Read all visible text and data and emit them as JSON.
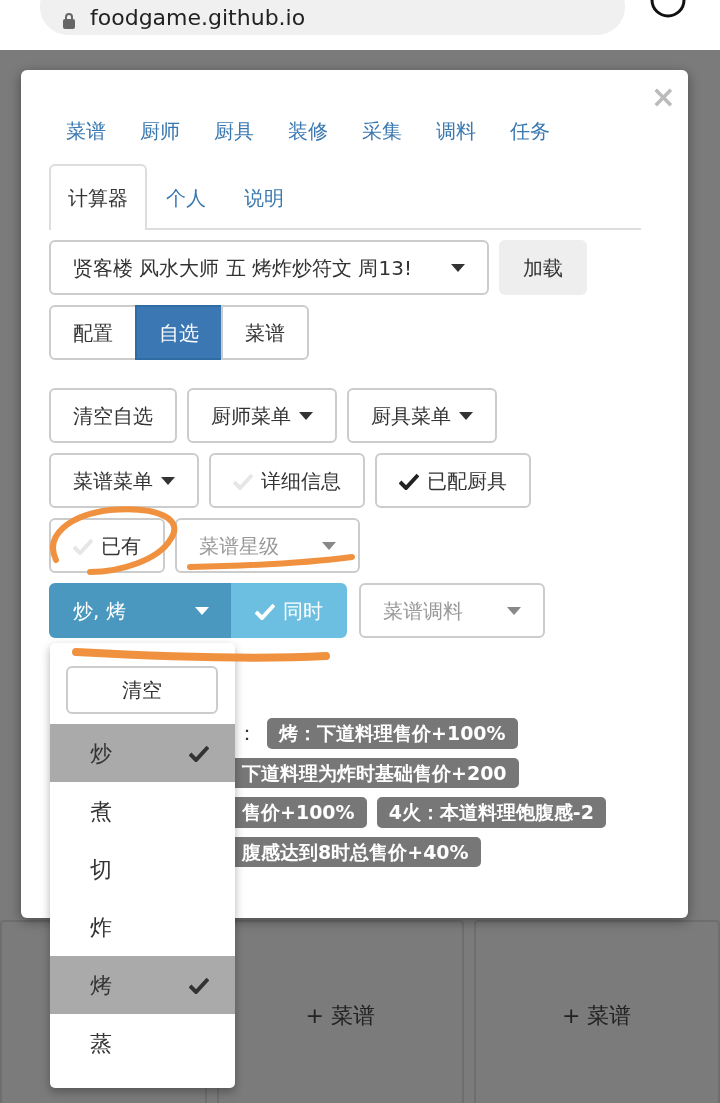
{
  "browser": {
    "url": "foodgame.github.io"
  },
  "modal": {
    "close": "×",
    "top_nav": [
      {
        "label": "菜谱"
      },
      {
        "label": "厨师"
      },
      {
        "label": "厨具"
      },
      {
        "label": "装修"
      },
      {
        "label": "采集"
      },
      {
        "label": "调料"
      },
      {
        "label": "任务"
      }
    ],
    "sub_tabs": [
      {
        "label": "计算器",
        "selected": true
      },
      {
        "label": "个人",
        "selected": false
      },
      {
        "label": "说明",
        "selected": false
      }
    ],
    "preset_select": {
      "value": "贤客楼 风水大师 五 烤炸炒符文 周13!"
    },
    "load_button": "加载",
    "mode_buttons": [
      {
        "label": "配置",
        "selected": false
      },
      {
        "label": "自选",
        "selected": true
      },
      {
        "label": "菜谱",
        "selected": false
      }
    ],
    "button_rows": [
      [
        {
          "kind": "button",
          "label": "清空自选"
        },
        {
          "kind": "dropdown",
          "label": "厨师菜单"
        },
        {
          "kind": "dropdown",
          "label": "厨具菜单"
        }
      ],
      [
        {
          "kind": "dropdown",
          "label": "菜谱菜单"
        },
        {
          "kind": "toggle",
          "label": "详细信息",
          "checked": false
        },
        {
          "kind": "toggle",
          "label": "已配厨具",
          "checked": true
        }
      ],
      [
        {
          "kind": "toggle",
          "label": "已有",
          "checked": false
        },
        {
          "kind": "select",
          "label": "菜谱星级"
        }
      ],
      [
        {
          "kind": "multi-select",
          "label": "炒, 烤",
          "open": true
        },
        {
          "kind": "joined-toggle",
          "label": "同时",
          "checked": true
        },
        {
          "kind": "select",
          "label": "菜谱调料"
        }
      ]
    ],
    "effects": {
      "prefix": "：",
      "rows": [
        [
          "烤：下道料理售价+100%"
        ],
        [
          "下道料理为炸时基础售价+200"
        ],
        [
          "售价+100%",
          "4火：本道料理饱腹感-2"
        ],
        [
          "腹感达到8时总售价+40%"
        ]
      ]
    }
  },
  "method_menu": {
    "clear_button": "清空",
    "items": [
      {
        "label": "炒",
        "selected": true
      },
      {
        "label": "煮",
        "selected": false
      },
      {
        "label": "切",
        "selected": false
      },
      {
        "label": "炸",
        "selected": false
      },
      {
        "label": "烤",
        "selected": true
      },
      {
        "label": "蒸",
        "selected": false
      }
    ]
  },
  "background_slots": [
    {
      "label": "+ 菜谱"
    },
    {
      "label": "+ 菜谱"
    }
  ]
}
